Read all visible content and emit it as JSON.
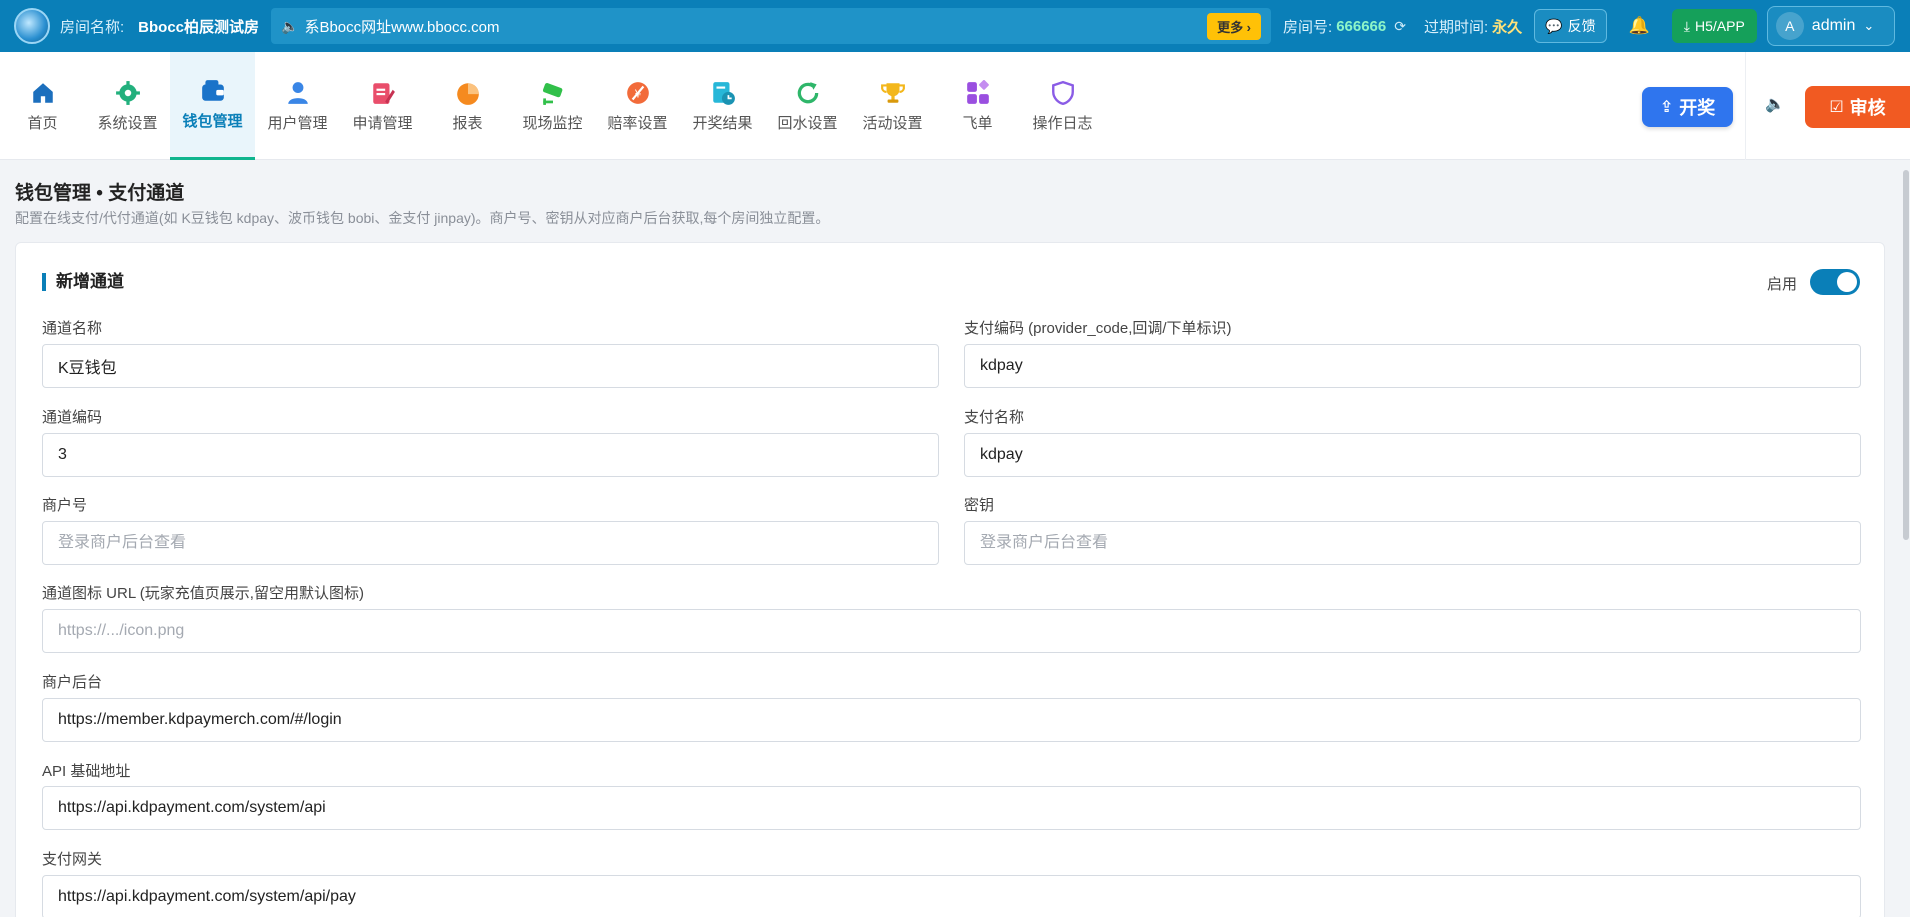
{
  "header": {
    "room_label": "房间名称:",
    "room_name": "Bbocc柏辰测试房",
    "notice_text": "系Bbocc网址www.bbocc.com",
    "more_label": "更多 ›",
    "room_no_label": "房间号:",
    "room_no": "666666",
    "expire_label": "过期时间:",
    "expire_value": "永久",
    "feedback_label": "反馈",
    "h5_label": "H5/APP",
    "avatar_letter": "A",
    "username": "admin",
    "caret": "⌄"
  },
  "nav": {
    "items": [
      {
        "label": "首页",
        "icon": "home-icon",
        "color": "#1c6fbd"
      },
      {
        "label": "系统设置",
        "icon": "gear-icon",
        "color": "#22b07d"
      },
      {
        "label": "钱包管理",
        "icon": "wallet-icon",
        "color": "#1a73c9"
      },
      {
        "label": "用户管理",
        "icon": "user-icon",
        "color": "#3a86e6"
      },
      {
        "label": "申请管理",
        "icon": "edit-form-icon",
        "color": "#e94e6b"
      },
      {
        "label": "报表",
        "icon": "pie-chart-icon",
        "color": "#f58a1f"
      },
      {
        "label": "现场监控",
        "icon": "camera-icon",
        "color": "#31c04a"
      },
      {
        "label": "赔率设置",
        "icon": "odds-icon",
        "color": "#f26b3a"
      },
      {
        "label": "开奖结果",
        "icon": "result-icon",
        "color": "#27b7d8"
      },
      {
        "label": "回水设置",
        "icon": "refresh-icon",
        "color": "#2fb66a"
      },
      {
        "label": "活动设置",
        "icon": "trophy-icon",
        "color": "#f3b71b"
      },
      {
        "label": "飞单",
        "icon": "apps-icon",
        "color": "#9a4fe0"
      },
      {
        "label": "操作日志",
        "icon": "shield-icon",
        "color": "#8a5ce6"
      }
    ],
    "draw_button": "开奖",
    "review_button": "审核"
  },
  "page": {
    "title": "钱包管理 • 支付通道",
    "description": "配置在线支付/代付通道(如 K豆钱包 kdpay、波币钱包 bobi、金支付 jinpay)。商户号、密钥从对应商户后台获取,每个房间独立配置。"
  },
  "form": {
    "card_title": "新增通道",
    "enable_label": "启用",
    "enabled": true,
    "channel_name_label": "通道名称",
    "channel_name": "K豆钱包",
    "provider_code_label": "支付编码 (provider_code,回调/下单标识)",
    "provider_code": "kdpay",
    "channel_code_label": "通道编码",
    "channel_code": "3",
    "pay_name_label": "支付名称",
    "pay_name": "kdpay",
    "merchant_no_label": "商户号",
    "merchant_no": "",
    "merchant_no_placeholder": "登录商户后台查看",
    "secret_label": "密钥",
    "secret": "",
    "secret_placeholder": "登录商户后台查看",
    "icon_url_label": "通道图标 URL (玩家充值页展示,留空用默认图标)",
    "icon_url": "",
    "icon_url_placeholder": "https://.../icon.png",
    "merchant_backend_label": "商户后台",
    "merchant_backend": "https://member.kdpaymerch.com/#/login",
    "api_base_label": "API 基础地址",
    "api_base": "https://api.kdpayment.com/system/api",
    "gateway_label": "支付网关",
    "gateway": "https://api.kdpayment.com/system/api/pay"
  }
}
